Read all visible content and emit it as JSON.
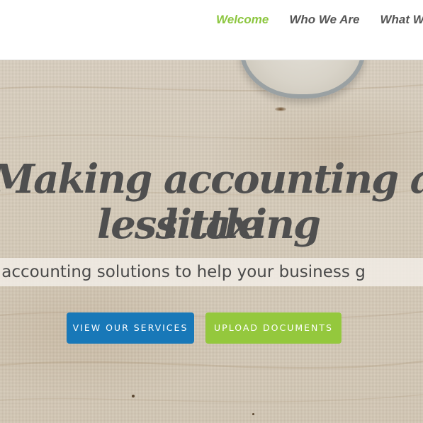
{
  "nav": {
    "items": [
      {
        "label": "Welcome",
        "active": true
      },
      {
        "label": "Who We Are",
        "active": false
      },
      {
        "label": "What W",
        "active": false
      }
    ]
  },
  "hero": {
    "headline_line1": "Making accounting a little",
    "headline_line2": "less taxing",
    "tagline": "Personalized accounting solutions to help your business g",
    "buttons": {
      "services": "VIEW OUR SERVICES",
      "upload": "UPLOAD DOCUMENTS"
    }
  },
  "colors": {
    "nav_active": "#8cc63f",
    "nav_text": "#555555",
    "services_button": "#1878b8",
    "upload_button": "#94c83d",
    "headline": "#4f4f4f"
  }
}
